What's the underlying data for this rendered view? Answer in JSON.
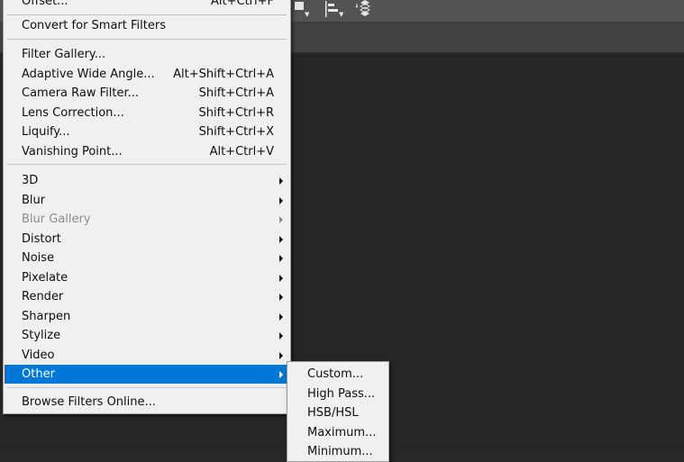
{
  "filter_menu": {
    "items_top": [
      {
        "label": "Offset...",
        "shortcut": "Alt+Ctrl+F"
      }
    ],
    "convert": {
      "label": "Convert for Smart Filters"
    },
    "items_main": [
      {
        "label": "Filter Gallery...",
        "shortcut": ""
      },
      {
        "label": "Adaptive Wide Angle...",
        "shortcut": "Alt+Shift+Ctrl+A"
      },
      {
        "label": "Camera Raw Filter...",
        "shortcut": "Shift+Ctrl+A"
      },
      {
        "label": "Lens Correction...",
        "shortcut": "Shift+Ctrl+R"
      },
      {
        "label": "Liquify...",
        "shortcut": "Shift+Ctrl+X"
      },
      {
        "label": "Vanishing Point...",
        "shortcut": "Alt+Ctrl+V"
      }
    ],
    "submenus": [
      {
        "label": "3D"
      },
      {
        "label": "Blur"
      },
      {
        "label": "Blur Gallery"
      },
      {
        "label": "Distort"
      },
      {
        "label": "Noise"
      },
      {
        "label": "Pixelate"
      },
      {
        "label": "Render"
      },
      {
        "label": "Sharpen"
      },
      {
        "label": "Stylize"
      },
      {
        "label": "Video"
      },
      {
        "label": "Other"
      }
    ],
    "browse": {
      "label": "Browse Filters Online..."
    }
  },
  "other_submenu": {
    "items": [
      {
        "label": "Custom..."
      },
      {
        "label": "High Pass..."
      },
      {
        "label": "HSB/HSL"
      },
      {
        "label": "Maximum..."
      },
      {
        "label": "Minimum..."
      }
    ]
  },
  "colors": {
    "menu_bg": "#f0f0f0",
    "highlight": "#0078d7",
    "disabled_text": "#8d8d8d",
    "workspace": "#282828"
  },
  "icons": [
    "align-left-icon",
    "distribute-layers-icon"
  ]
}
